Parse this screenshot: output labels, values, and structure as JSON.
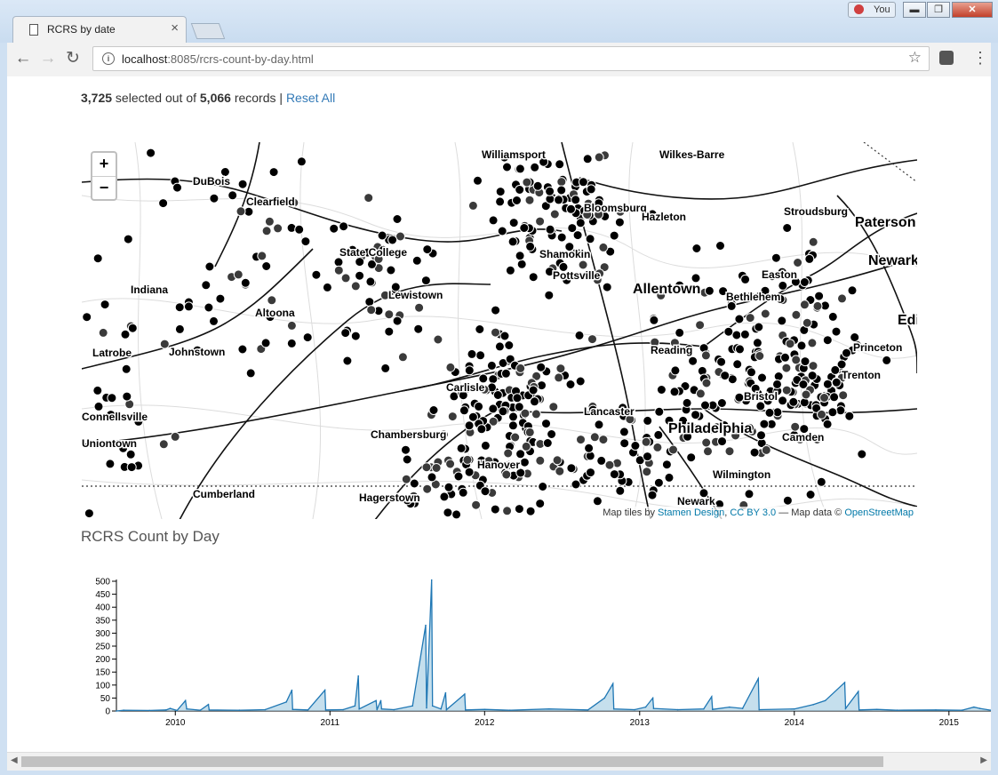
{
  "browser": {
    "tab_title": "RCRS by date",
    "user_label": "You",
    "url_host": "localhost",
    "url_rest": ":8085/rcrs-count-by-day.html",
    "min_label": "▬",
    "max_label": "❐",
    "close_label": "✕"
  },
  "counter": {
    "selected": "3,725",
    "mid_text": " selected out of ",
    "total": "5,066",
    "end_text": " records | ",
    "reset_label": "Reset All"
  },
  "map": {
    "zoom_in": "+",
    "zoom_out": "−",
    "attribution_prefix": "Map tiles by ",
    "attribution_link1": "Stamen Design",
    "attribution_sep": ", ",
    "attribution_link2": "CC BY 3.0",
    "attribution_mid": " — Map data © ",
    "attribution_link3": "OpenStreetMap",
    "cities": [
      {
        "name": "Williamsport"
      },
      {
        "name": "Wilkes-Barre"
      },
      {
        "name": "DuBois"
      },
      {
        "name": "Clearfield"
      },
      {
        "name": "Bloomsburg"
      },
      {
        "name": "Hazleton"
      },
      {
        "name": "Stroudsburg"
      },
      {
        "name": "Paterson"
      },
      {
        "name": "Newark"
      },
      {
        "name": "State College"
      },
      {
        "name": "Shamokin"
      },
      {
        "name": "Easton"
      },
      {
        "name": "Indiana"
      },
      {
        "name": "Pottsville"
      },
      {
        "name": "Allentown"
      },
      {
        "name": "Bethlehem"
      },
      {
        "name": "Lewistown"
      },
      {
        "name": "Altoona"
      },
      {
        "name": "Edison"
      },
      {
        "name": "Princeton"
      },
      {
        "name": "Latrobe"
      },
      {
        "name": "Johnstown"
      },
      {
        "name": "Reading"
      },
      {
        "name": "Trenton"
      },
      {
        "name": "Carlisle"
      },
      {
        "name": "Lancaster"
      },
      {
        "name": "Bristol"
      },
      {
        "name": "Connellsville"
      },
      {
        "name": "Philadelphia"
      },
      {
        "name": "Chambersburg"
      },
      {
        "name": "Camden"
      },
      {
        "name": "Uniontown"
      },
      {
        "name": "Hanover"
      },
      {
        "name": "Wilmington"
      },
      {
        "name": "Cumberland"
      },
      {
        "name": "Hagerstown"
      },
      {
        "name": "Newark"
      }
    ]
  },
  "chart_title": "RCRS Count by Day",
  "chart_data": {
    "type": "area",
    "title": "RCRS Count by Day",
    "xlabel": "",
    "ylabel": "",
    "ylim": [
      0,
      500
    ],
    "xlim": [
      "2009-08-15",
      "2015-04-10"
    ],
    "yticks": [
      0,
      50,
      100,
      150,
      200,
      250,
      300,
      350,
      400,
      450,
      500
    ],
    "xticks": [
      "2010",
      "2011",
      "2012",
      "2013",
      "2014",
      "2015"
    ],
    "points": [
      {
        "x": "2009-08-15",
        "y": 0
      },
      {
        "x": "2009-09-01",
        "y": 3
      },
      {
        "x": "2009-11-01",
        "y": 2
      },
      {
        "x": "2009-12-10",
        "y": 4
      },
      {
        "x": "2009-12-20",
        "y": 10
      },
      {
        "x": "2010-01-05",
        "y": 2
      },
      {
        "x": "2010-01-25",
        "y": 40
      },
      {
        "x": "2010-01-28",
        "y": 8
      },
      {
        "x": "2010-03-01",
        "y": 3
      },
      {
        "x": "2010-03-20",
        "y": 25
      },
      {
        "x": "2010-03-22",
        "y": 4
      },
      {
        "x": "2010-06-01",
        "y": 3
      },
      {
        "x": "2010-08-01",
        "y": 5
      },
      {
        "x": "2010-09-20",
        "y": 35
      },
      {
        "x": "2010-10-03",
        "y": 80
      },
      {
        "x": "2010-10-05",
        "y": 6
      },
      {
        "x": "2010-11-10",
        "y": 4
      },
      {
        "x": "2010-12-20",
        "y": 80
      },
      {
        "x": "2010-12-22",
        "y": 4
      },
      {
        "x": "2011-02-01",
        "y": 5
      },
      {
        "x": "2011-03-01",
        "y": 20
      },
      {
        "x": "2011-03-09",
        "y": 135
      },
      {
        "x": "2011-03-11",
        "y": 8
      },
      {
        "x": "2011-04-20",
        "y": 40
      },
      {
        "x": "2011-04-22",
        "y": 5
      },
      {
        "x": "2011-05-01",
        "y": 40
      },
      {
        "x": "2011-05-03",
        "y": 8
      },
      {
        "x": "2011-06-01",
        "y": 5
      },
      {
        "x": "2011-07-15",
        "y": 20
      },
      {
        "x": "2011-08-15",
        "y": 330
      },
      {
        "x": "2011-08-17",
        "y": 12
      },
      {
        "x": "2011-08-29",
        "y": 505
      },
      {
        "x": "2011-08-31",
        "y": 20
      },
      {
        "x": "2011-09-20",
        "y": 8
      },
      {
        "x": "2011-10-01",
        "y": 70
      },
      {
        "x": "2011-10-03",
        "y": 5
      },
      {
        "x": "2011-11-15",
        "y": 65
      },
      {
        "x": "2011-11-17",
        "y": 4
      },
      {
        "x": "2012-01-01",
        "y": 6
      },
      {
        "x": "2012-03-01",
        "y": 3
      },
      {
        "x": "2012-06-01",
        "y": 8
      },
      {
        "x": "2012-09-01",
        "y": 4
      },
      {
        "x": "2012-10-10",
        "y": 50
      },
      {
        "x": "2012-10-30",
        "y": 105
      },
      {
        "x": "2012-11-01",
        "y": 8
      },
      {
        "x": "2012-12-20",
        "y": 5
      },
      {
        "x": "2013-01-15",
        "y": 15
      },
      {
        "x": "2013-02-01",
        "y": 50
      },
      {
        "x": "2013-02-03",
        "y": 10
      },
      {
        "x": "2013-04-01",
        "y": 5
      },
      {
        "x": "2013-06-01",
        "y": 8
      },
      {
        "x": "2013-06-20",
        "y": 55
      },
      {
        "x": "2013-06-22",
        "y": 6
      },
      {
        "x": "2013-08-01",
        "y": 15
      },
      {
        "x": "2013-09-01",
        "y": 10
      },
      {
        "x": "2013-10-08",
        "y": 125
      },
      {
        "x": "2013-10-10",
        "y": 5
      },
      {
        "x": "2014-01-01",
        "y": 8
      },
      {
        "x": "2014-02-15",
        "y": 25
      },
      {
        "x": "2014-03-15",
        "y": 40
      },
      {
        "x": "2014-04-30",
        "y": 110
      },
      {
        "x": "2014-05-02",
        "y": 10
      },
      {
        "x": "2014-06-01",
        "y": 75
      },
      {
        "x": "2014-06-03",
        "y": 4
      },
      {
        "x": "2014-07-15",
        "y": 6
      },
      {
        "x": "2014-09-01",
        "y": 3
      },
      {
        "x": "2014-12-01",
        "y": 4
      },
      {
        "x": "2015-02-01",
        "y": 3
      },
      {
        "x": "2015-03-01",
        "y": 15
      },
      {
        "x": "2015-03-15",
        "y": 10
      },
      {
        "x": "2015-04-10",
        "y": 3
      }
    ],
    "line_color": "#1f77b4",
    "fill_color": "#9ecae1"
  }
}
